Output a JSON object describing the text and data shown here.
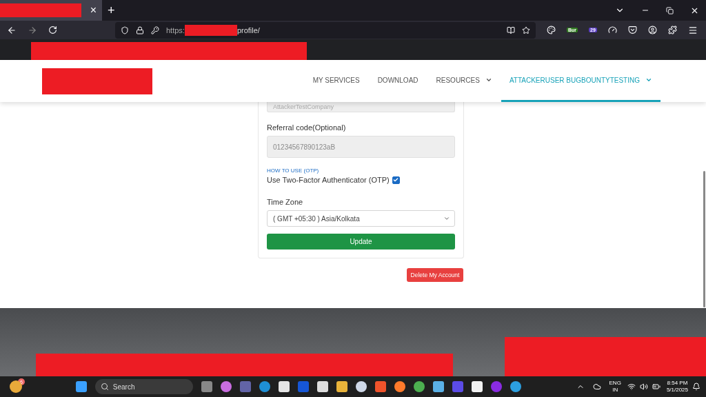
{
  "browser": {
    "tab": {
      "close": "×"
    },
    "new_tab": "+",
    "url": {
      "scheme": "https:",
      "path": "profile/"
    },
    "extension_badges": [
      "Bur",
      "29"
    ]
  },
  "site": {
    "nav": [
      {
        "label": "MY SERVICES",
        "selected": false,
        "dropdown": false
      },
      {
        "label": "DOWNLOAD",
        "selected": false,
        "dropdown": false
      },
      {
        "label": "RESOURCES",
        "selected": false,
        "dropdown": true
      },
      {
        "label": "ATTACKERUSER BUGBOUNTYTESTING",
        "selected": true,
        "dropdown": true
      }
    ]
  },
  "form": {
    "company_value": "AttackerTestCompany",
    "referral_label": "Referral code(Optional)",
    "referral_value": "01234567890123aB",
    "otp_link": "HOW TO USE (OTP)",
    "otp_label": "Use Two-Factor Authenticator (OTP)",
    "otp_checked": true,
    "timezone_label": "Time Zone",
    "timezone_value": "( GMT +05:30 ) Asia/Kolkata",
    "update_button": "Update",
    "delete_button": "Delete My Account"
  },
  "taskbar": {
    "weather_badge": "6",
    "search_placeholder": "Search",
    "language": "ENG",
    "region": "IN",
    "time": "8:54 PM",
    "date": "5/1/2025"
  }
}
